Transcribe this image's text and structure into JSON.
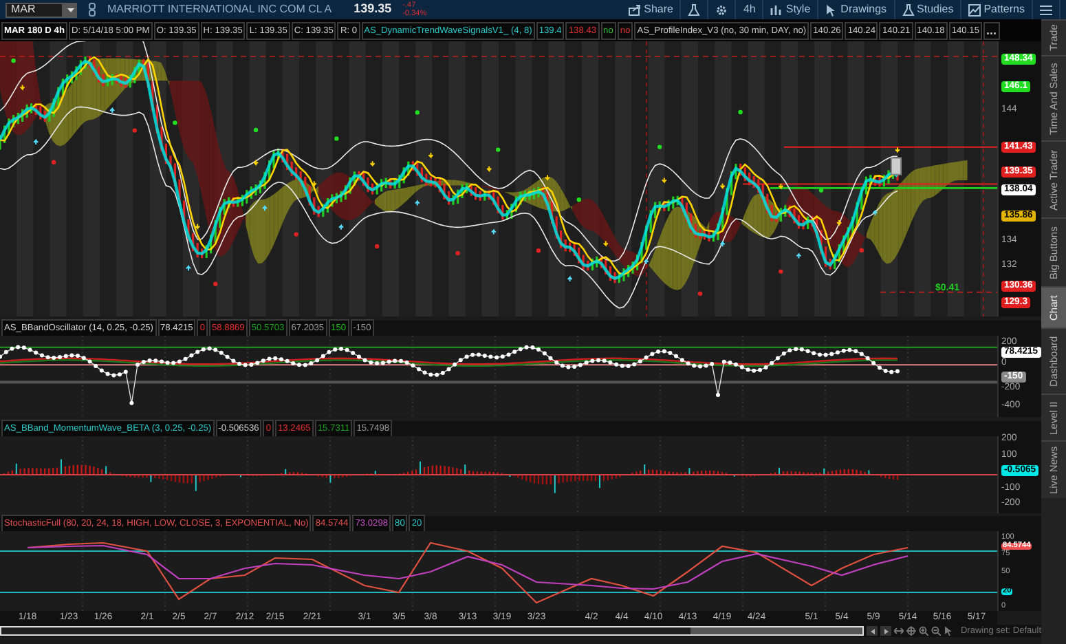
{
  "toolbar": {
    "symbol": "MAR",
    "company": "MARRIOTT INTERNATIONAL INC COM CL A",
    "last": "139.35",
    "change": "-.47",
    "change_percent": "-0.34%",
    "buttons": [
      {
        "kind": "share",
        "label": "Share"
      },
      {
        "kind": "flask"
      },
      {
        "kind": "gear"
      },
      {
        "kind": "text",
        "label": "4h"
      },
      {
        "kind": "style",
        "label": "Style"
      },
      {
        "kind": "drawings",
        "label": "Drawings"
      },
      {
        "kind": "studies",
        "label": "Studies"
      },
      {
        "kind": "patterns",
        "label": "Patterns"
      },
      {
        "kind": "menu"
      }
    ]
  },
  "chart": {
    "header": [
      {
        "kind": "title",
        "text": "MAR 180 D 4h",
        "color": "#ffffff"
      },
      {
        "text": "D: 5/14/18 5:00 PM",
        "color": "#c8c8c8"
      },
      {
        "text": "O: 139.35",
        "color": "#c8c8c8"
      },
      {
        "text": "H: 139.35",
        "color": "#c8c8c8"
      },
      {
        "text": "L: 139.35",
        "color": "#c8c8c8"
      },
      {
        "text": "C: 139.35",
        "color": "#c8c8c8"
      },
      {
        "text": "R: 0",
        "color": "#c8c8c8"
      },
      {
        "text": "AS_DynamicTrendWaveSignalsV1_ (4, 8)",
        "color": "#2cc8c8"
      },
      {
        "text": "139.4",
        "color": "#2cc8c8"
      },
      {
        "text": "138.43",
        "color": "#e03030"
      },
      {
        "text": "no",
        "color": "#2bbf2b"
      },
      {
        "text": "no",
        "color": "#e03030"
      },
      {
        "text": "AS_ProfileIndex_V3 (no, 30 min, DAY, no)",
        "color": "#c8c8c8"
      },
      {
        "text": "140.26",
        "color": "#c8c8c8"
      },
      {
        "text": "140.24",
        "color": "#c8c8c8"
      },
      {
        "text": "140.21",
        "color": "#c8c8c8"
      },
      {
        "text": "140.18",
        "color": "#c8c8c8"
      },
      {
        "text": "140.15",
        "color": "#c8c8c8"
      },
      {
        "kind": "more",
        "text": "...",
        "color": "#c8c8c8"
      }
    ],
    "axis_labels": [
      {
        "kind": "tag",
        "text": "148.34",
        "color": "#22dd22"
      },
      {
        "kind": "tag",
        "text": "146.1",
        "color": "#22dd22"
      },
      {
        "kind": "tick",
        "text": "144"
      },
      {
        "kind": "tag",
        "text": "141.43",
        "color": "#e02020"
      },
      {
        "kind": "tag",
        "text": "139.35",
        "color": "#e02020"
      },
      {
        "kind": "tag",
        "text": "138.04",
        "color": "#ffffff"
      },
      {
        "kind": "tag",
        "text": "135.86",
        "color": "#e0b400"
      },
      {
        "kind": "tick",
        "text": "134"
      },
      {
        "kind": "tick",
        "text": "132"
      },
      {
        "kind": "tag",
        "text": "130.36",
        "color": "#e02020"
      },
      {
        "kind": "tag",
        "text": "129.3",
        "color": "#e02020"
      }
    ],
    "signal_label": "$0.41"
  },
  "oscillator": {
    "header": [
      {
        "text": "AS_BBandOscillator (14, 0.25, -0.25)",
        "color": "#d0d0d0"
      },
      {
        "text": "78.4215",
        "color": "#d0d0d0"
      },
      {
        "text": "0",
        "color": "#e03030"
      },
      {
        "text": "58.8869",
        "color": "#e03030"
      },
      {
        "text": "50.5703",
        "color": "#1e9e1e"
      },
      {
        "text": "67.2035",
        "color": "#9a9a9a"
      },
      {
        "text": "150",
        "color": "#22bb22"
      },
      {
        "text": "-150",
        "color": "#9a9a9a"
      }
    ],
    "axis_labels": [
      {
        "kind": "tick",
        "text": "200"
      },
      {
        "kind": "tag",
        "text": "78.4215",
        "color": "#ffffff"
      },
      {
        "kind": "tick",
        "text": "0"
      },
      {
        "kind": "tag",
        "text": "-150",
        "color": "#8a8a8a"
      },
      {
        "kind": "tick",
        "text": "-200"
      },
      {
        "kind": "tick",
        "text": "-400"
      }
    ]
  },
  "momentum": {
    "header": [
      {
        "text": "AS_BBand_MomentumWave_BETA (3, 0.25, -0.25)",
        "color": "#2cc8c8"
      },
      {
        "text": "-0.506536",
        "color": "#d0d0d0"
      },
      {
        "text": "0",
        "color": "#e03030"
      },
      {
        "text": "13.2465",
        "color": "#e03030"
      },
      {
        "text": "15.7311",
        "color": "#1e9e1e"
      },
      {
        "text": "15.7498",
        "color": "#9a9a9a"
      }
    ],
    "axis_labels": [
      {
        "kind": "tick",
        "text": "200"
      },
      {
        "kind": "tick",
        "text": "100"
      },
      {
        "kind": "tag",
        "text": "-0.5065",
        "color": "#00e5e5"
      },
      {
        "kind": "tick",
        "text": "-100"
      },
      {
        "kind": "tick",
        "text": "-200"
      }
    ]
  },
  "stochastic": {
    "header": [
      {
        "text": "StochasticFull (80, 20, 24, 18, HIGH, LOW, CLOSE, 3, EXPONENTIAL, No)",
        "color": "#e05050"
      },
      {
        "text": "84.5744",
        "color": "#e05050"
      },
      {
        "text": "73.0298",
        "color": "#c050c0"
      },
      {
        "text": "80",
        "color": "#2cc8c8"
      },
      {
        "text": "20",
        "color": "#2cc8c8"
      }
    ],
    "axis_labels": [
      {
        "kind": "tag",
        "text": "84.5744",
        "color": "#f05050"
      },
      {
        "kind": "tag",
        "text": "20",
        "color": "#00e5e5"
      }
    ],
    "chart_data": {
      "type": "line",
      "categories": [
        "1/18",
        "1/23",
        "1/26",
        "2/1",
        "2/5",
        "2/7",
        "2/12",
        "2/15",
        "2/21",
        "3/1",
        "3/5",
        "3/8",
        "3/13",
        "3/19",
        "3/23",
        "4/2",
        "4/4",
        "4/10",
        "4/13",
        "4/19",
        "4/24",
        "5/1",
        "5/4",
        "5/9",
        "5/14",
        "5/16",
        "5/17"
      ],
      "series": [
        {
          "color": "#e05040",
          "values": [
            85,
            90,
            92,
            80,
            10,
            40,
            45,
            70,
            68,
            30,
            20,
            92,
            80,
            55,
            5,
            40,
            30,
            15,
            50,
            87,
            78,
            30,
            55,
            75,
            85,
            null,
            null
          ]
        },
        {
          "color": "#c040c0",
          "values": [
            85,
            87,
            88,
            75,
            40,
            40,
            55,
            62,
            60,
            45,
            40,
            50,
            72,
            60,
            35,
            30,
            26,
            25,
            35,
            65,
            76,
            58,
            45,
            60,
            73,
            null,
            null
          ]
        }
      ],
      "ylim": [
        -7,
        109
      ],
      "yticks": [
        0,
        50,
        75,
        100
      ],
      "grid": true,
      "ref_lines": [
        {
          "axis": "y",
          "value": 80,
          "color": "#1fb8b8"
        },
        {
          "axis": "y",
          "value": 20,
          "color": "#1fb8b8"
        }
      ]
    }
  },
  "bottom_bar": {
    "drawing_set": "Drawing set: Default"
  },
  "sidebar": {
    "tabs": [
      {
        "label": "Trade",
        "selected": false
      },
      {
        "label": "Time And Sales",
        "selected": false
      },
      {
        "label": "Active Trader",
        "selected": false
      },
      {
        "label": "Big Buttons",
        "selected": false
      },
      {
        "label": "Chart",
        "selected": true
      },
      {
        "label": "Dashboard",
        "selected": false
      },
      {
        "label": "Level II",
        "selected": false
      },
      {
        "label": "Live News",
        "selected": false
      }
    ]
  }
}
